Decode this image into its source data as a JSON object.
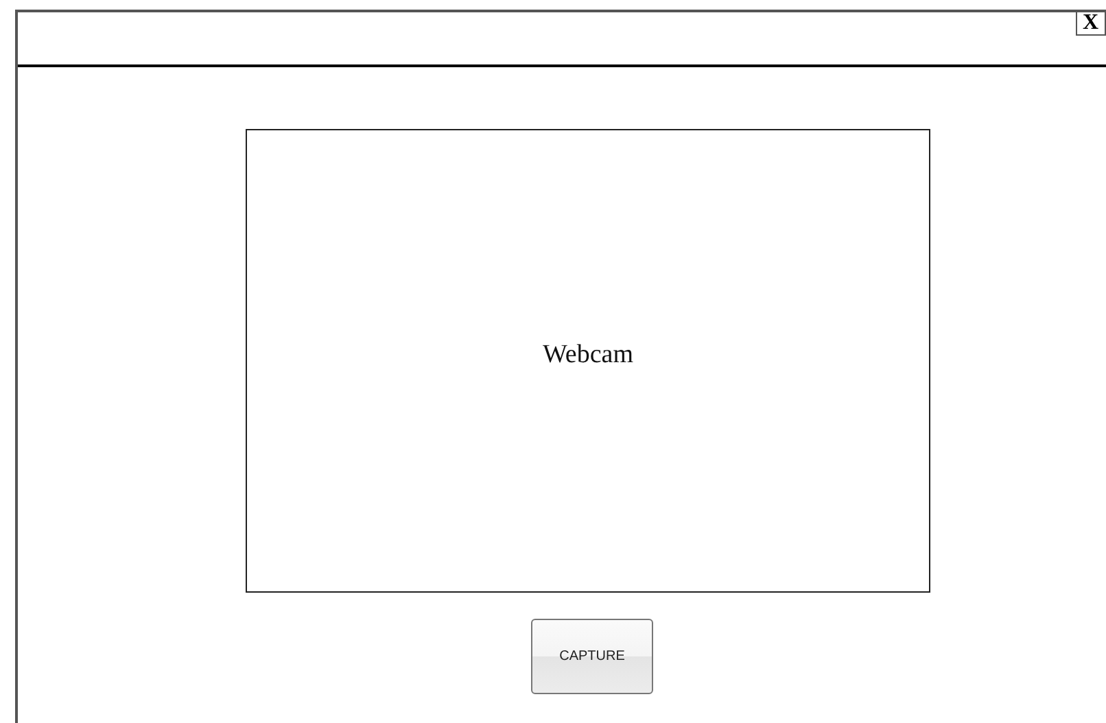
{
  "window": {
    "close_label": "X"
  },
  "webcam": {
    "label": "Webcam"
  },
  "capture_button": {
    "label": "CAPTURE"
  }
}
